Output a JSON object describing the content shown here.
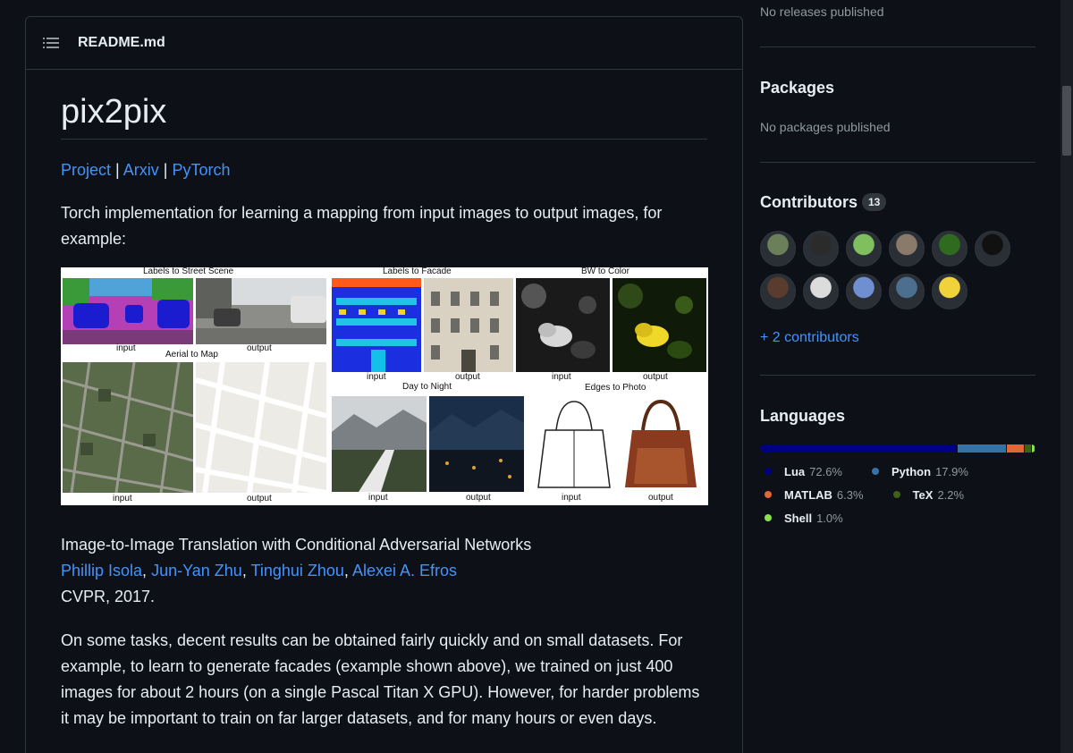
{
  "readme": {
    "filename": "README.md",
    "title": "pix2pix",
    "links": [
      "Project",
      "Arxiv",
      "PyTorch"
    ],
    "separator": "|",
    "intro": "Torch implementation for learning a mapping from input images to output images, for example:",
    "figure": {
      "panels": {
        "labels_street": "Labels to Street Scene",
        "labels_facade": "Labels to Facade",
        "bw_color": "BW to Color",
        "aerial_map": "Aerial to Map",
        "day_night": "Day to Night",
        "edges_photo": "Edges to Photo"
      },
      "input_label": "input",
      "output_label": "output"
    },
    "paper_title": "Image-to-Image Translation with Conditional Adversarial Networks",
    "authors": [
      "Phillip Isola",
      "Jun-Yan Zhu",
      "Tinghui Zhou",
      "Alexei A. Efros"
    ],
    "author_sep": ",",
    "venue": "CVPR, 2017.",
    "paragraph2": "On some tasks, decent results can be obtained fairly quickly and on small datasets. For example, to learn to generate facades (example shown above), we trained on just 400 images for about 2 hours (on a single Pascal Titan X GPU). However, for harder problems it may be important to train on far larger datasets, and for many hours or even days."
  },
  "sidebar": {
    "releases_empty": "No releases published",
    "packages": {
      "title": "Packages",
      "empty": "No packages published"
    },
    "contributors": {
      "title": "Contributors",
      "count": "13",
      "more_link": "+ 2 contributors",
      "avatars": [
        {
          "icon": "avatar-person-1",
          "color": "#6b7f5a"
        },
        {
          "icon": "avatar-person-2",
          "color": "#2b2b2b"
        },
        {
          "icon": "avatar-identicon-green",
          "color": "#7fbf5e"
        },
        {
          "icon": "avatar-person-3",
          "color": "#8a7a6a"
        },
        {
          "icon": "avatar-leaf",
          "color": "#2f6b1f"
        },
        {
          "icon": "avatar-person-dark",
          "color": "#111111"
        },
        {
          "icon": "avatar-person-4",
          "color": "#5a3c2e"
        },
        {
          "icon": "avatar-sketch",
          "color": "#dcdcdc"
        },
        {
          "icon": "avatar-identicon-blue",
          "color": "#6f8fd0"
        },
        {
          "icon": "avatar-person-5",
          "color": "#4d6f8f"
        },
        {
          "icon": "avatar-minion",
          "color": "#f0d23a"
        }
      ]
    },
    "languages": {
      "title": "Languages",
      "items": [
        {
          "name": "Lua",
          "percent": "72.6%",
          "value": 72.6,
          "color": "#000080"
        },
        {
          "name": "Python",
          "percent": "17.9%",
          "value": 17.9,
          "color": "#3572A5"
        },
        {
          "name": "MATLAB",
          "percent": "6.3%",
          "value": 6.3,
          "color": "#e16737"
        },
        {
          "name": "TeX",
          "percent": "2.2%",
          "value": 2.2,
          "color": "#3D6117"
        },
        {
          "name": "Shell",
          "percent": "1.0%",
          "value": 1.0,
          "color": "#89e051"
        }
      ]
    }
  }
}
